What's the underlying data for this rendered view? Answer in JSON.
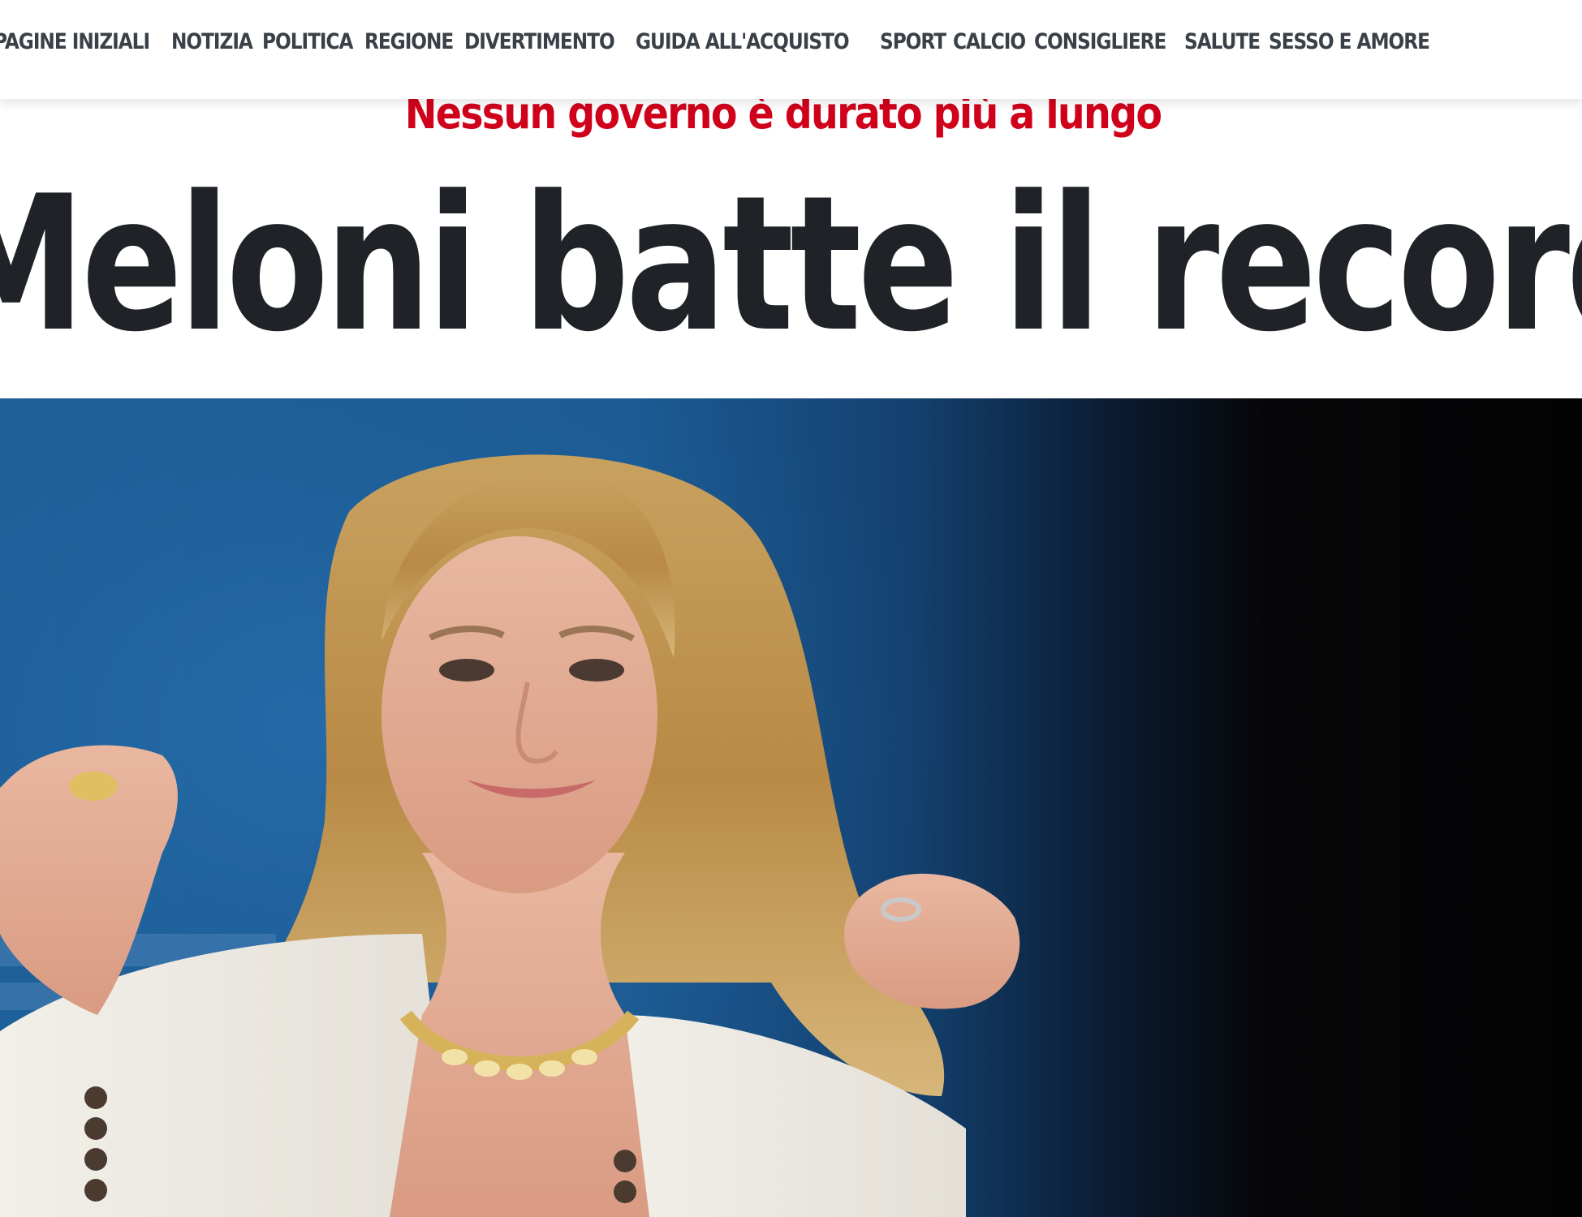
{
  "nav": {
    "items": [
      "PAGINE INIZIALI",
      "NOTIZIA",
      "POLITICA",
      "REGIONE",
      "DIVERTIMENTO",
      "GUIDA ALL'ACQUISTO",
      "SPORT",
      "CALCIO",
      "CONSIGLIERE",
      "SALUTE",
      "SESSO E AMORE"
    ]
  },
  "article": {
    "kicker": "Nessun governo è durato più a lungo",
    "headline": "Meloni batte il record italiano"
  },
  "colors": {
    "kicker": "#d0021b",
    "headline": "#1f2226",
    "nav_text": "#3a4047",
    "hero_background_left": "#1e5f99",
    "hero_background_right": "#030304"
  }
}
